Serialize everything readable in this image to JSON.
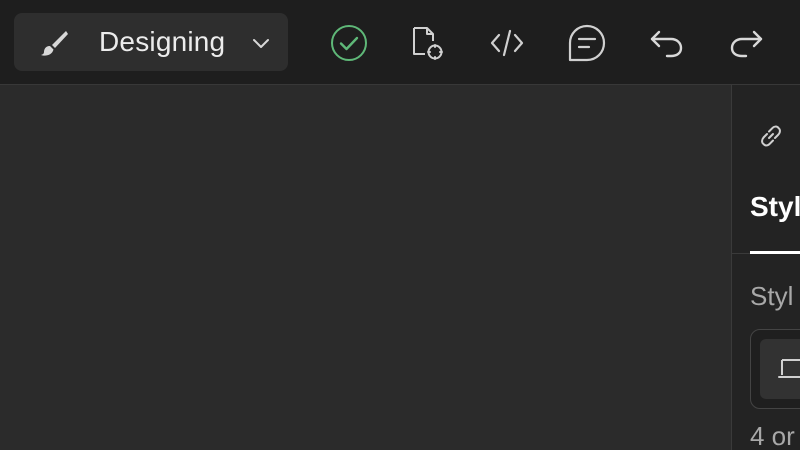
{
  "toolbar": {
    "mode_label": "Designing",
    "icons": {
      "brush": "brush-icon",
      "chevron": "chevron-down-icon",
      "status": "check-circle-icon",
      "page_settings": "page-settings-icon",
      "code": "code-icon",
      "comments": "comment-icon",
      "undo": "undo-icon",
      "redo": "redo-icon"
    },
    "colors": {
      "status_ok": "#5fb878"
    }
  },
  "panel": {
    "link_icon": "link-icon",
    "active_tab": "Styl",
    "section_label": "Styl",
    "selector_icon": "device-icon",
    "footnote": "4 or"
  }
}
